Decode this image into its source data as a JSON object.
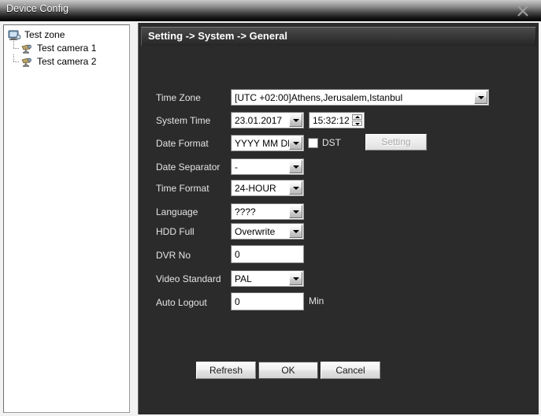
{
  "window": {
    "title": "Device Config",
    "close_icon": "close-x-icon"
  },
  "sidebar": {
    "nodes": [
      {
        "label": "Test zone",
        "icon": "device-zone-icon",
        "level": 0
      },
      {
        "label": "Test camera 1",
        "icon": "camera-icon",
        "level": 1
      },
      {
        "label": "Test camera 2",
        "icon": "camera-icon",
        "level": 1
      }
    ]
  },
  "content": {
    "header": "Setting -> System -> General",
    "fields": {
      "time_zone": {
        "label": "Time Zone",
        "value": "[UTC +02:00]Athens,Jerusalem,Istanbul"
      },
      "system_time": {
        "label": "System Time",
        "date_value": "23.01.2017",
        "time_value": "15:32:12"
      },
      "date_format": {
        "label": "Date Format",
        "value": "YYYY MM DD"
      },
      "dst": {
        "label": "DST",
        "checked": false
      },
      "dst_setting_button": {
        "label": "Setting",
        "disabled": true
      },
      "date_separator": {
        "label": "Date Separator",
        "value": "-"
      },
      "time_format": {
        "label": "Time Format",
        "value": "24-HOUR"
      },
      "language": {
        "label": "Language",
        "value": "????"
      },
      "hdd_full": {
        "label": "HDD Full",
        "value": "Overwrite"
      },
      "dvr_no": {
        "label": "DVR No",
        "value": "0"
      },
      "video_standard": {
        "label": "Video Standard",
        "value": "PAL"
      },
      "auto_logout": {
        "label": "Auto Logout",
        "value": "0",
        "unit": "Min"
      }
    },
    "buttons": {
      "refresh": "Refresh",
      "ok": "OK",
      "cancel": "Cancel"
    }
  },
  "colors": {
    "panel_bg": "#2b2b2b",
    "panel_text": "#e4e4e4",
    "field_bg": "#ffffff",
    "titlebar_text": "#ffffff"
  }
}
